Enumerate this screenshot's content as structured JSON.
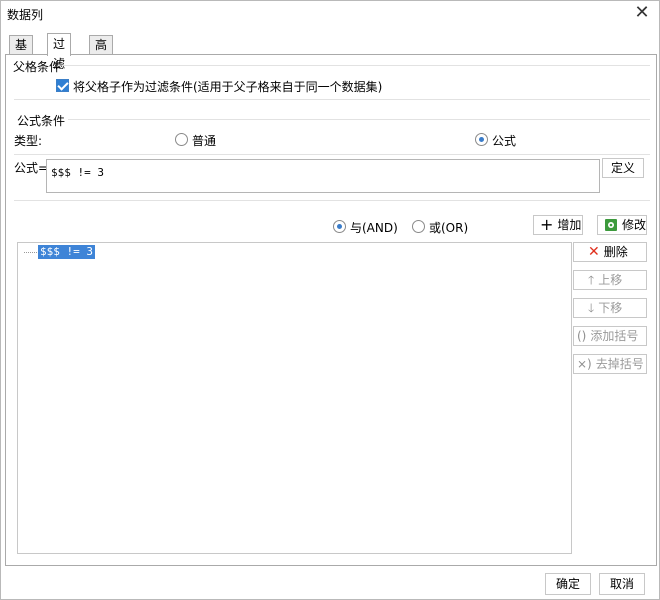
{
  "window": {
    "title": "数据列"
  },
  "tabs": [
    {
      "label": "基本"
    },
    {
      "label": "过滤"
    },
    {
      "label": "高级"
    }
  ],
  "parent_condition": {
    "group_title": "父格条件",
    "checkbox_label": "将父格子作为过滤条件(适用于父子格来自于同一个数据集)",
    "checked": true
  },
  "formula_condition": {
    "group_title": "公式条件",
    "type_label": "类型:",
    "type_options": [
      {
        "label": "普通",
        "checked": false
      },
      {
        "label": "公式",
        "checked": true
      }
    ],
    "formula_label": "公式=",
    "formula_value": "$$$ != 3",
    "define_button": "定义"
  },
  "logic": {
    "and_label": "与(AND)",
    "or_label": "或(OR)",
    "selected": "and"
  },
  "actions": {
    "add": "增加",
    "modify": "修改",
    "delete": "删除",
    "move_up": "上移",
    "move_down": "下移",
    "add_bracket": "添加括号",
    "remove_bracket": "去掉括号"
  },
  "condition_list": [
    "$$$ != 3"
  ],
  "footer": {
    "ok": "确定",
    "cancel": "取消"
  }
}
